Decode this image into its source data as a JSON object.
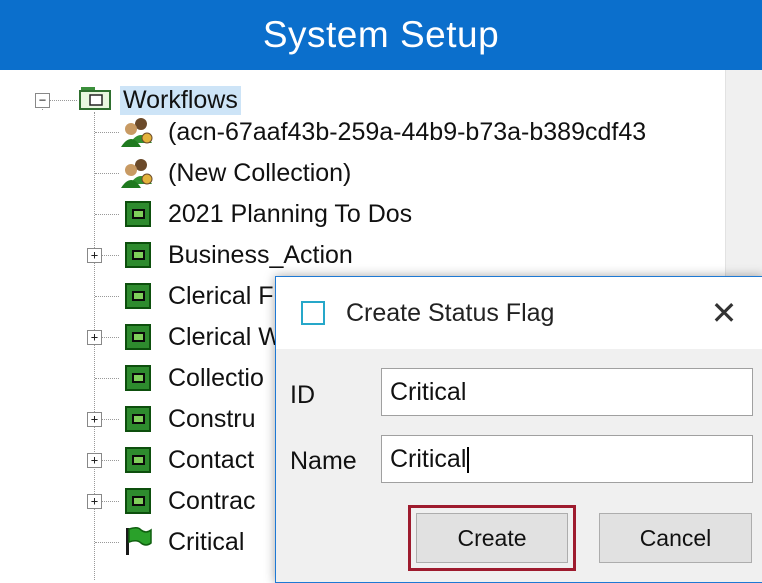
{
  "header": {
    "title": "System Setup"
  },
  "tree": {
    "root": {
      "label": "Workflows",
      "expander": "−"
    },
    "children": [
      {
        "label": "(acn-67aaf43b-259a-44b9-b73a-b389cdf43",
        "icon": "people-icon",
        "expander": ""
      },
      {
        "label": "(New Collection)",
        "icon": "people-icon",
        "expander": ""
      },
      {
        "label": "2021 Planning To Dos",
        "icon": "workflow-icon",
        "expander": ""
      },
      {
        "label": "Business_Action",
        "icon": "workflow-icon",
        "expander": "+"
      },
      {
        "label": "Clerical F",
        "icon": "workflow-icon",
        "expander": ""
      },
      {
        "label": "Clerical W",
        "icon": "workflow-icon",
        "expander": "+"
      },
      {
        "label": "Collectio",
        "icon": "workflow-icon",
        "expander": ""
      },
      {
        "label": "Constru",
        "icon": "workflow-icon",
        "expander": "+"
      },
      {
        "label": "Contact",
        "icon": "workflow-icon",
        "expander": "+"
      },
      {
        "label": "Contrac",
        "icon": "workflow-icon",
        "expander": "+"
      },
      {
        "label": "Critical",
        "icon": "flag-icon",
        "expander": ""
      }
    ]
  },
  "dialog": {
    "title": "Create Status Flag",
    "close": "✕",
    "id_label": "ID",
    "id_value": "Critical",
    "name_label": "Name",
    "name_value": "Critical",
    "create_button": "Create",
    "cancel_button": "Cancel"
  },
  "colors": {
    "header_bg": "#0b6fcc",
    "highlight": "#9e1b2e",
    "selection": "#cde4f7"
  }
}
